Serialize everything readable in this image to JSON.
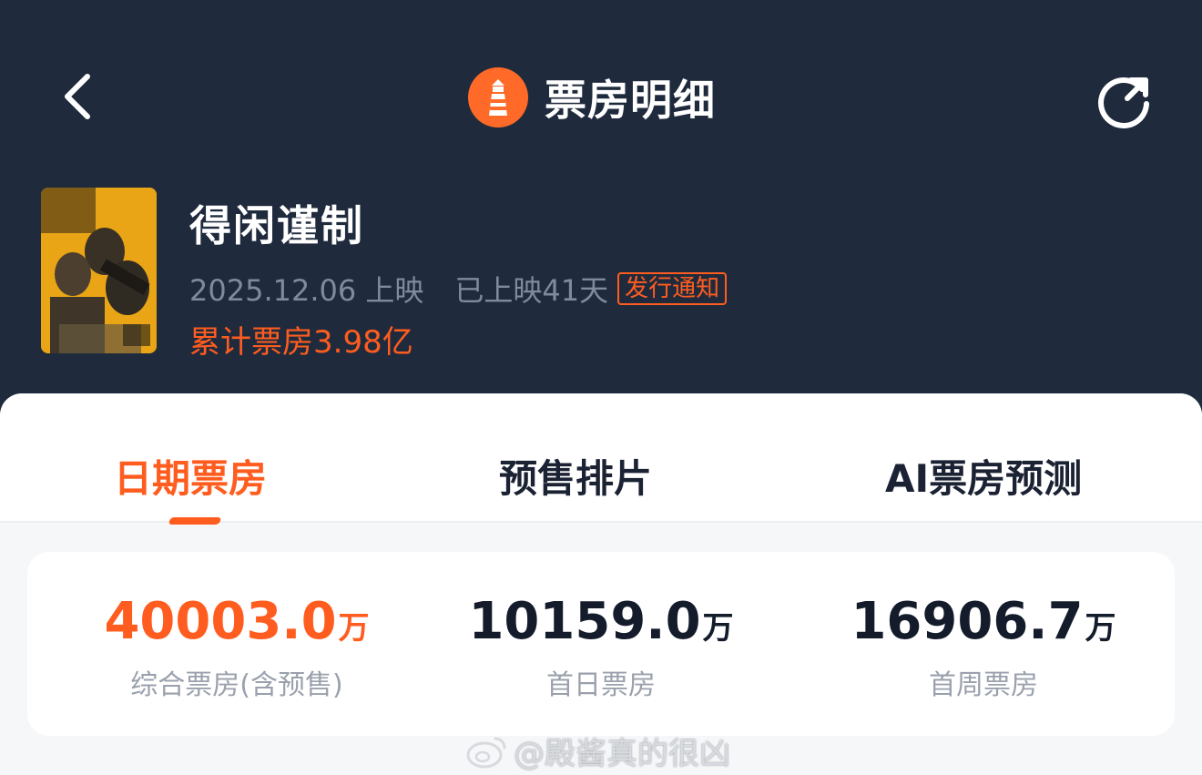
{
  "header": {
    "title": "票房明细",
    "back_icon": "chevron-left-icon",
    "refresh_icon": "refresh-icon",
    "logo_icon": "lighthouse-icon"
  },
  "movie": {
    "name": "得闲谨制",
    "release_date": "2025.12.06 上映",
    "days_released": "已上映41天",
    "notice_badge": "发行通知",
    "cumulative_box_office": "累计票房3.98亿"
  },
  "tabs": [
    {
      "label": "日期票房",
      "active": true
    },
    {
      "label": "预售排片",
      "active": false
    },
    {
      "label": "AI票房预测",
      "active": false
    }
  ],
  "stats": [
    {
      "value": "40003.0",
      "unit": "万",
      "label": "综合票房(含预售)"
    },
    {
      "value": "10159.0",
      "unit": "万",
      "label": "首日票房"
    },
    {
      "value": "16906.7",
      "unit": "万",
      "label": "首周票房"
    }
  ],
  "watermark": "@殿酱真的很凶",
  "colors": {
    "background": "#1f2b3d",
    "accent": "#ff5c1f",
    "panel": "#f6f7f9"
  }
}
